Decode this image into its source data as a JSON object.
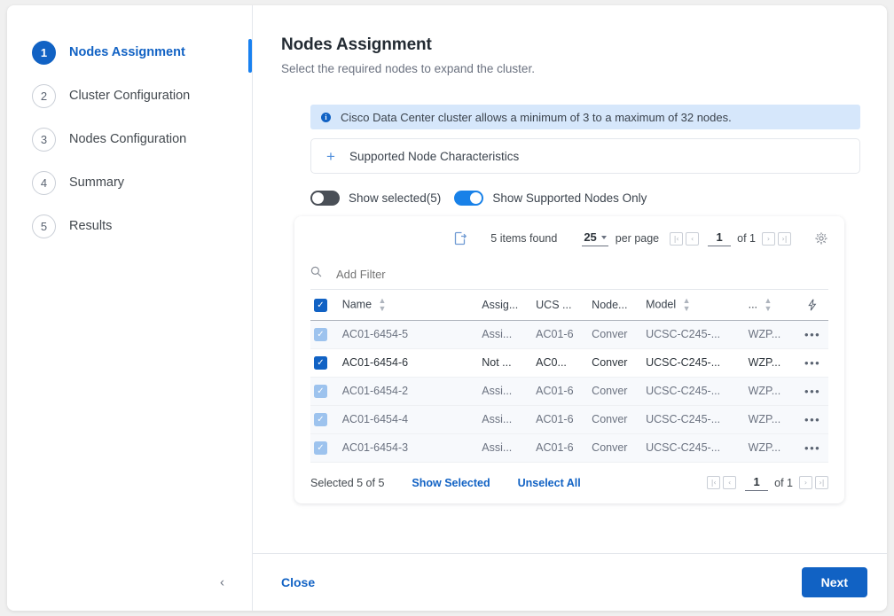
{
  "sidebar": {
    "items": [
      {
        "num": "1",
        "label": "Nodes Assignment"
      },
      {
        "num": "2",
        "label": "Cluster Configuration"
      },
      {
        "num": "3",
        "label": "Nodes Configuration"
      },
      {
        "num": "4",
        "label": "Summary"
      },
      {
        "num": "5",
        "label": "Results"
      }
    ]
  },
  "header": {
    "title": "Nodes Assignment",
    "subtitle": "Select the required nodes to expand the cluster."
  },
  "banner": {
    "icon": "info-icon",
    "glyph": "i",
    "text": "Cisco Data Center cluster allows a minimum of 3 to a maximum of 32 nodes."
  },
  "expander": {
    "icon": "plus-icon",
    "glyph": "+",
    "label": "Supported Node Characteristics"
  },
  "toggles": [
    {
      "label": "Show selected(5)",
      "state": "off"
    },
    {
      "label": "Show Supported Nodes Only",
      "state": "on"
    }
  ],
  "toolbar": {
    "export_icon": "export-icon",
    "items_found": "5 items found",
    "per_page_value": "25",
    "per_page_label": "per page",
    "page_number": "1",
    "page_of": "of 1",
    "first_glyph": "|‹",
    "prev_glyph": "‹",
    "next_glyph": "›",
    "last_glyph": "›|",
    "gear_icon": "gear-icon"
  },
  "filter": {
    "icon": "search-icon",
    "placeholder": "Add Filter",
    "value": ""
  },
  "table": {
    "select_all_checked": true,
    "columns": [
      {
        "label": "Name",
        "sortable": true
      },
      {
        "label": "Assig...",
        "sortable": false
      },
      {
        "label": "UCS ...",
        "sortable": false
      },
      {
        "label": "Node...",
        "sortable": false
      },
      {
        "label": "Model",
        "sortable": true
      },
      {
        "label": "...",
        "sortable": true
      }
    ],
    "action_column_icon": "lightning-bolt-icon",
    "rows": [
      {
        "name": "AC01-6454-5",
        "assigned": "Assi...",
        "ucs": "AC01-6",
        "node": "Conver",
        "model": "UCSC-C245-...",
        "serial": "WZP...",
        "checked": true,
        "enabled": false,
        "ucs_link": false
      },
      {
        "name": "AC01-6454-6",
        "assigned": "Not ...",
        "ucs": "AC0...",
        "node": "Conver",
        "model": "UCSC-C245-...",
        "serial": "WZP...",
        "checked": true,
        "enabled": true,
        "ucs_link": true
      },
      {
        "name": "AC01-6454-2",
        "assigned": "Assi...",
        "ucs": "AC01-6",
        "node": "Conver",
        "model": "UCSC-C245-...",
        "serial": "WZP...",
        "checked": true,
        "enabled": false,
        "ucs_link": false
      },
      {
        "name": "AC01-6454-4",
        "assigned": "Assi...",
        "ucs": "AC01-6",
        "node": "Conver",
        "model": "UCSC-C245-...",
        "serial": "WZP...",
        "checked": true,
        "enabled": false,
        "ucs_link": false
      },
      {
        "name": "AC01-6454-3",
        "assigned": "Assi...",
        "ucs": "AC01-6",
        "node": "Conver",
        "model": "UCSC-C245-...",
        "serial": "WZP...",
        "checked": true,
        "enabled": false,
        "ucs_link": false
      }
    ],
    "row_action_glyph": "•••"
  },
  "table_footer": {
    "selected_text": "Selected 5 of 5",
    "show_selected": "Show Selected",
    "unselect_all": "Unselect All",
    "page_number": "1",
    "page_of": "of 1"
  },
  "bottom": {
    "collapse_icon": "chevron-left-icon",
    "collapse_glyph": "‹",
    "close_label": "Close",
    "next_label": "Next"
  },
  "colors": {
    "accent": "#1162c4",
    "toggle_on": "#1881e8",
    "banner_bg": "#d6e7fb",
    "link": "#1f7fe0"
  }
}
